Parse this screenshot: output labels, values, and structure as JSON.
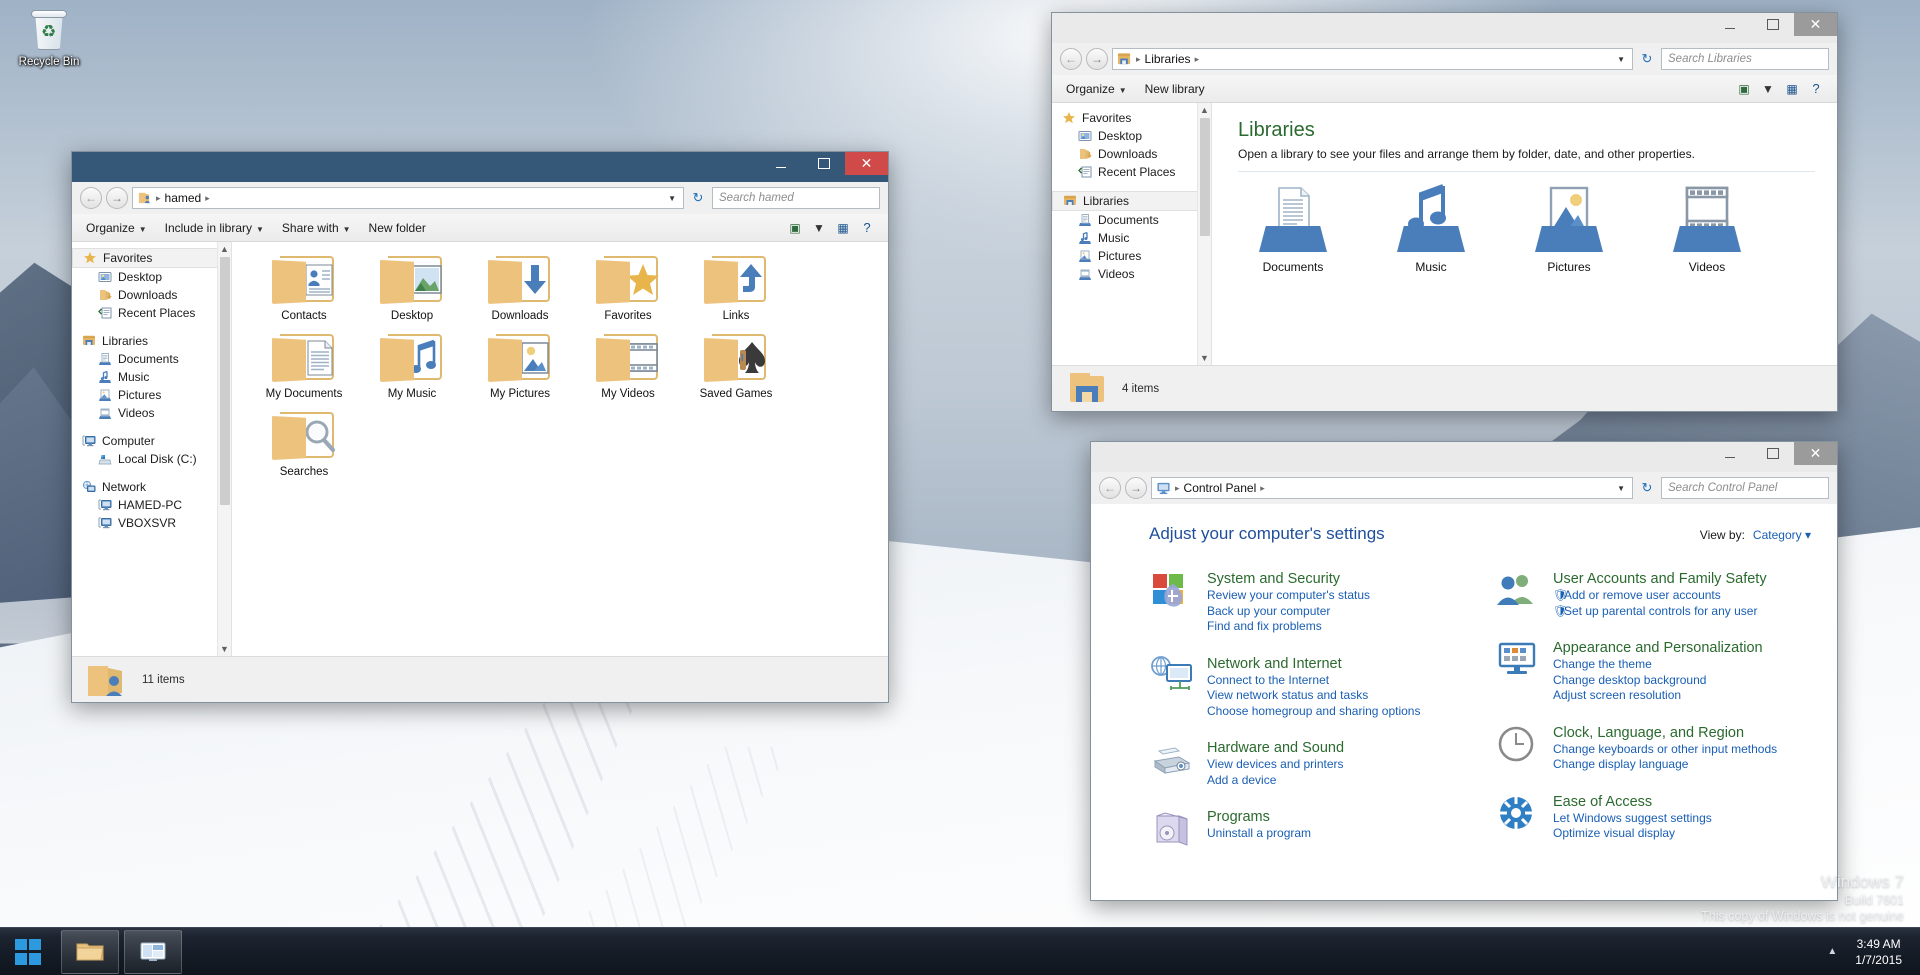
{
  "desktop": {
    "recycle_bin_label": "Recycle Bin",
    "watermark": {
      "line1": "Windows 7",
      "line2": "Build 7601",
      "line3": "This copy of Windows is not genuine"
    }
  },
  "taskbar": {
    "start_label": "Start",
    "buttons": [
      {
        "name": "windows-explorer",
        "label": "Windows Explorer"
      },
      {
        "name": "control-panel",
        "label": "Control Panel"
      }
    ],
    "tray": {
      "show_hidden_label": "Show hidden icons",
      "time": "3:49 AM",
      "date": "1/7/2015"
    }
  },
  "windows": {
    "hamed": {
      "title": "hamed",
      "titlebar": {
        "minimize": "Minimize",
        "maximize": "Maximize",
        "close": "Close"
      },
      "address": {
        "crumb": "hamed",
        "separator": "▸"
      },
      "search_placeholder": "Search hamed",
      "toolbar": {
        "organize": "Organize",
        "include_in_library": "Include in library",
        "share_with": "Share with",
        "new_folder": "New folder",
        "help": "?"
      },
      "navpane": [
        {
          "label": "Favorites",
          "icon": "star-icon",
          "level": "root",
          "selected": true
        },
        {
          "label": "Desktop",
          "icon": "desktop-icon",
          "level": "child"
        },
        {
          "label": "Downloads",
          "icon": "downloads-icon",
          "level": "child"
        },
        {
          "label": "Recent Places",
          "icon": "recent-places-icon",
          "level": "child"
        },
        {
          "label": "",
          "icon": "",
          "level": "gap"
        },
        {
          "label": "Libraries",
          "icon": "libraries-icon",
          "level": "root"
        },
        {
          "label": "Documents",
          "icon": "documents-icon",
          "level": "child"
        },
        {
          "label": "Music",
          "icon": "music-icon",
          "level": "child"
        },
        {
          "label": "Pictures",
          "icon": "pictures-icon",
          "level": "child"
        },
        {
          "label": "Videos",
          "icon": "videos-icon",
          "level": "child"
        },
        {
          "label": "",
          "icon": "",
          "level": "gap"
        },
        {
          "label": "Computer",
          "icon": "computer-icon",
          "level": "root"
        },
        {
          "label": "Local Disk (C:)",
          "icon": "disk-icon",
          "level": "child"
        },
        {
          "label": "",
          "icon": "",
          "level": "gap"
        },
        {
          "label": "Network",
          "icon": "network-icon",
          "level": "root"
        },
        {
          "label": "HAMED-PC",
          "icon": "computer-icon",
          "level": "child"
        },
        {
          "label": "VBOXSVR",
          "icon": "computer-icon",
          "level": "child"
        }
      ],
      "items": [
        {
          "name": "Contacts",
          "emblem": "contact-card"
        },
        {
          "name": "Desktop",
          "emblem": "picture"
        },
        {
          "name": "Downloads",
          "emblem": "down-arrow"
        },
        {
          "name": "Favorites",
          "emblem": "star"
        },
        {
          "name": "Links",
          "emblem": "up-arrow"
        },
        {
          "name": "My Documents",
          "emblem": "document"
        },
        {
          "name": "My Music",
          "emblem": "note"
        },
        {
          "name": "My Pictures",
          "emblem": "photo"
        },
        {
          "name": "My Videos",
          "emblem": "film"
        },
        {
          "name": "Saved Games",
          "emblem": "spade"
        },
        {
          "name": "Searches",
          "emblem": "magnifier"
        }
      ],
      "status": "11 items"
    },
    "libraries": {
      "title": "Libraries",
      "address": {
        "crumb": "Libraries"
      },
      "search_placeholder": "Search Libraries",
      "toolbar": {
        "organize": "Organize",
        "new_library": "New library",
        "help": "?"
      },
      "navpane": [
        {
          "label": "Favorites",
          "icon": "star-icon",
          "level": "root"
        },
        {
          "label": "Desktop",
          "icon": "desktop-icon",
          "level": "child"
        },
        {
          "label": "Downloads",
          "icon": "downloads-icon",
          "level": "child"
        },
        {
          "label": "Recent Places",
          "icon": "recent-places-icon",
          "level": "child"
        },
        {
          "label": "",
          "icon": "",
          "level": "gap"
        },
        {
          "label": "Libraries",
          "icon": "libraries-icon",
          "level": "root",
          "selected": true
        },
        {
          "label": "Documents",
          "icon": "documents-icon",
          "level": "child"
        },
        {
          "label": "Music",
          "icon": "music-icon",
          "level": "child"
        },
        {
          "label": "Pictures",
          "icon": "pictures-icon",
          "level": "child"
        },
        {
          "label": "Videos",
          "icon": "videos-icon",
          "level": "child"
        }
      ],
      "header": {
        "title": "Libraries",
        "subtitle": "Open a library to see your files and arrange them by folder, date, and other properties."
      },
      "items": [
        {
          "name": "Documents",
          "icon": "document-library-icon"
        },
        {
          "name": "Music",
          "icon": "music-library-icon"
        },
        {
          "name": "Pictures",
          "icon": "pictures-library-icon"
        },
        {
          "name": "Videos",
          "icon": "videos-library-icon"
        }
      ],
      "status": "4 items"
    },
    "control_panel": {
      "title": "Control Panel",
      "address": {
        "crumb": "Control Panel"
      },
      "search_placeholder": "Search Control Panel",
      "page_title": "Adjust your computer's settings",
      "view_by": {
        "label": "View by:",
        "value": "Category"
      },
      "categories_left": [
        {
          "title": "System and Security",
          "icon": "shield-icon",
          "links": [
            {
              "text": "Review your computer's status",
              "shield": false
            },
            {
              "text": "Back up your computer",
              "shield": false
            },
            {
              "text": "Find and fix problems",
              "shield": false
            }
          ]
        },
        {
          "title": "Network and Internet",
          "icon": "network-globe-icon",
          "links": [
            {
              "text": "Connect to the Internet",
              "shield": false
            },
            {
              "text": "View network status and tasks",
              "shield": false
            },
            {
              "text": "Choose homegroup and sharing options",
              "shield": false
            }
          ]
        },
        {
          "title": "Hardware and Sound",
          "icon": "printer-icon",
          "links": [
            {
              "text": "View devices and printers",
              "shield": false
            },
            {
              "text": "Add a device",
              "shield": false
            }
          ]
        },
        {
          "title": "Programs",
          "icon": "programs-box-icon",
          "links": [
            {
              "text": "Uninstall a program",
              "shield": false
            }
          ]
        }
      ],
      "categories_right": [
        {
          "title": "User Accounts and Family Safety",
          "icon": "users-icon",
          "links": [
            {
              "text": "Add or remove user accounts",
              "shield": true
            },
            {
              "text": "Set up parental controls for any user",
              "shield": true
            }
          ]
        },
        {
          "title": "Appearance and Personalization",
          "icon": "appearance-icon",
          "links": [
            {
              "text": "Change the theme",
              "shield": false
            },
            {
              "text": "Change desktop background",
              "shield": false
            },
            {
              "text": "Adjust screen resolution",
              "shield": false
            }
          ]
        },
        {
          "title": "Clock, Language, and Region",
          "icon": "clock-icon",
          "links": [
            {
              "text": "Change keyboards or other input methods",
              "shield": false
            },
            {
              "text": "Change display language",
              "shield": false
            }
          ]
        },
        {
          "title": "Ease of Access",
          "icon": "ease-of-access-icon",
          "links": [
            {
              "text": "Let Windows suggest settings",
              "shield": false
            },
            {
              "text": "Optimize visual display",
              "shield": false
            }
          ]
        }
      ]
    }
  },
  "colors": {
    "active_titlebar": "#355878",
    "close_button": "#d04a4a",
    "link_blue": "#1a5fb4",
    "category_green": "#2b6a2f",
    "folder_yellow": "#edc27c",
    "library_blue": "#4a7ebb",
    "taskbar": "#141b25"
  }
}
